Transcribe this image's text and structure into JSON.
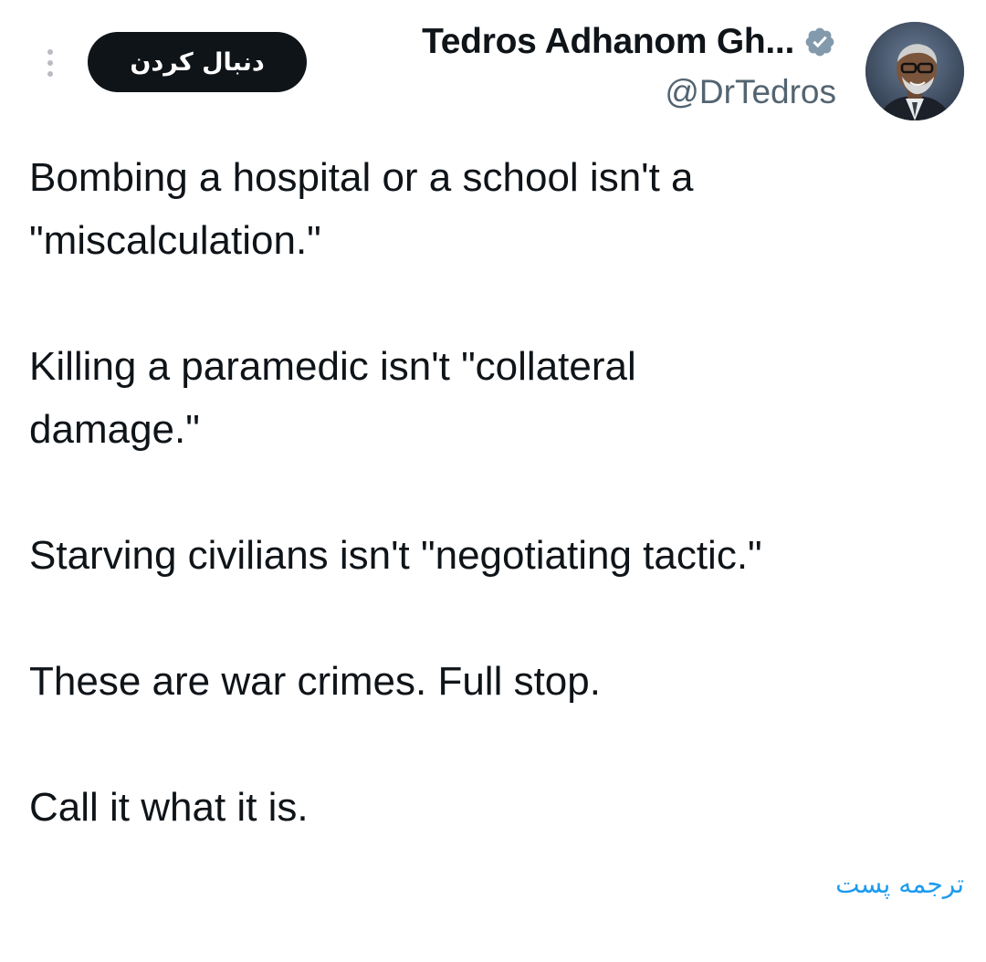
{
  "author": {
    "display_name": "Tedros Adhanom Gh...",
    "handle": "@DrTedros",
    "verified": true
  },
  "icons": {
    "more": "more-vertical-icon",
    "verified": "verified-badge-icon",
    "avatar": "profile-photo"
  },
  "colors": {
    "follow_button_bg": "#0f1419",
    "handle_text": "#536471",
    "verified_badge": "#829aab",
    "link": "#1d9bf0"
  },
  "follow_button": {
    "label": "دنبال کردن"
  },
  "tweet": {
    "paragraphs": [
      "Bombing a hospital or a school isn't a\n\"miscalculation.\"",
      "Killing a paramedic isn't \"collateral\ndamage.\"",
      "Starving civilians isn't \"negotiating tactic.\"",
      "These are war crimes. Full stop.",
      "Call it what it is."
    ]
  },
  "translate_link": {
    "label": "ترجمه پست"
  }
}
